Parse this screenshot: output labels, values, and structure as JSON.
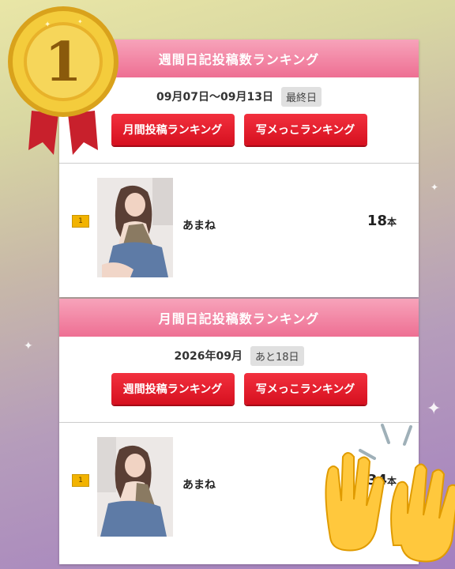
{
  "medal": {
    "rank_number": "1"
  },
  "weekly": {
    "header": "週間日記投稿数ランキング",
    "period": "09月07日〜09月13日",
    "badge": "最終日",
    "buttons": [
      "月間投稿ランキング",
      "写メっこランキング"
    ],
    "entry": {
      "rank": "1",
      "name": "あまね",
      "count": "18",
      "unit": "本"
    }
  },
  "monthly": {
    "header": "月間日記投稿数ランキング",
    "period": "2026年09月",
    "badge": "あと18日",
    "buttons": [
      "週間投稿ランキング",
      "写メっこランキング"
    ],
    "entry": {
      "rank": "1",
      "name": "あまね",
      "count": "34",
      "unit": "本"
    }
  },
  "colors": {
    "header": "#ee6f93",
    "button": "#e01b2b",
    "badge": "#f2b300"
  }
}
